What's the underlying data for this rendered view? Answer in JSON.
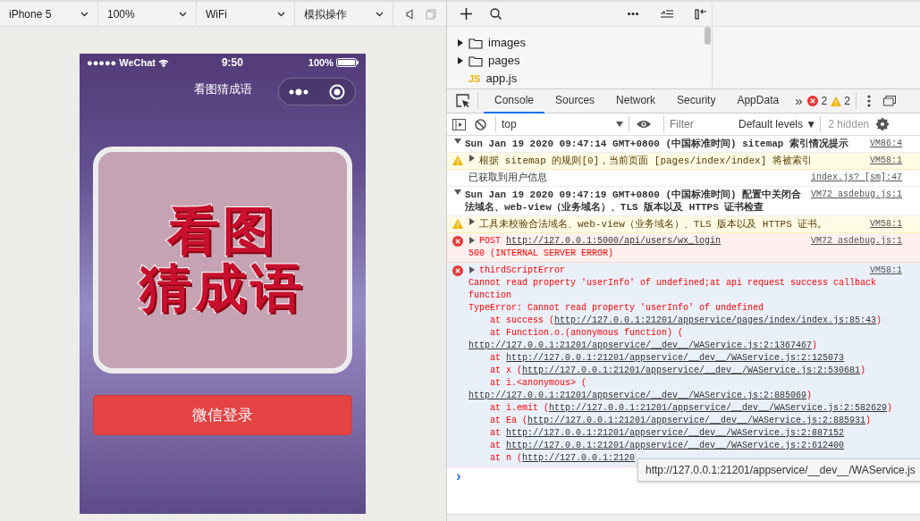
{
  "simulator_toolbar": {
    "dropdowns": [
      {
        "label": "iPhone 5"
      },
      {
        "label": "100%"
      },
      {
        "label": "WiFi"
      },
      {
        "label": "模拟操作"
      }
    ]
  },
  "phone": {
    "status_bar": {
      "carrier": "●●●●● WeChat",
      "time": "9:50",
      "battery": "100%"
    },
    "nav_title": "看图猜成语",
    "logo": {
      "lines": [
        "看图",
        "猜成语"
      ]
    },
    "login_button": "微信登录"
  },
  "file_tree": {
    "items": [
      {
        "label": "images",
        "kind": "folder",
        "expanded": false
      },
      {
        "label": "pages",
        "kind": "folder",
        "expanded": false
      },
      {
        "label": "app.js",
        "kind": "js",
        "badge": "JS"
      }
    ]
  },
  "devtools": {
    "tabs": [
      {
        "label": "Console",
        "selected": true
      },
      {
        "label": "Sources",
        "selected": false
      },
      {
        "label": "Network",
        "selected": false
      },
      {
        "label": "Security",
        "selected": false
      },
      {
        "label": "AppData",
        "selected": false
      }
    ],
    "more": "»",
    "error_count": "2",
    "warning_count": "2",
    "context": "top",
    "filter": {
      "placeholder": "Filter"
    },
    "levels": "Default levels ▼",
    "hidden": "2 hidden"
  },
  "console": {
    "messages": [
      {
        "kind": "group",
        "expanded": true,
        "highlighted": false,
        "text": "Sun Jan 19 2020 09:47:14 GMT+0800 (中国标准时间) sitemap 索引情况提示",
        "source": "VM86:4"
      },
      {
        "kind": "warning",
        "expanded": false,
        "highlighted": false,
        "text": "根据 sitemap 的规则[0]，当前页面 [pages/index/index] 将被索引",
        "source": "VM58:1"
      },
      {
        "kind": "log",
        "highlighted": false,
        "text": "已获取到用户信息",
        "source": "index.js? [sm]:47"
      },
      {
        "kind": "group",
        "expanded": true,
        "highlighted": false,
        "text": "Sun Jan 19 2020 09:47:19 GMT+0800 (中国标准时间) 配置中关闭合法域名、web-view（业务域名）、TLS 版本以及 HTTPS 证书检查",
        "source": "VM72 asdebug.js:1"
      },
      {
        "kind": "warning",
        "expanded": false,
        "highlighted": false,
        "text": "工具未校验合法域名、web-view（业务域名）、TLS 版本以及 HTTPS 证书。",
        "source": "VM58:1"
      },
      {
        "kind": "network_error",
        "expanded": false,
        "highlighted": false,
        "method": "POST",
        "url": "http://127.0.0.1:5000/api/users/wx_login",
        "status": "500 (INTERNAL SERVER ERROR)",
        "source": "VM72 asdebug.js:1"
      },
      {
        "kind": "script_error",
        "expanded": false,
        "highlighted": true,
        "title": "thirdScriptError",
        "source": "VM58:1",
        "lines": [
          "Cannot read property 'userInfo' of undefined;at api request success callback function",
          "TypeError: Cannot read property 'userInfo' of undefined"
        ],
        "stack": [
          {
            "before": "at success (",
            "url": "http://127.0.0.1:21201/appservice/pages/index/index.js:85:43",
            "after": ")"
          },
          {
            "before": "at Function.o.(anonymous function) (",
            "url": "http://127.0.0.1:21201/appservice/__dev__/WAService.js:2:1367467",
            "after": ")"
          },
          {
            "before": "at ",
            "url": "http://127.0.0.1:21201/appservice/__dev__/WAService.js:2:125073"
          },
          {
            "before": "at x (",
            "url": "http://127.0.0.1:21201/appservice/__dev__/WAService.js:2:530681",
            "after": ")"
          },
          {
            "before": "at i.<anonymous> (",
            "url": "http://127.0.0.1:21201/appservice/__dev__/WAService.js:2:885069",
            "after": ")"
          },
          {
            "before": "at i.emit (",
            "url": "http://127.0.0.1:21201/appservice/__dev__/WAService.js:2:582629",
            "after": ")"
          },
          {
            "before": "at Ea (",
            "url": "http://127.0.0.1:21201/appservice/__dev__/WAService.js:2:885931",
            "after": ")"
          },
          {
            "before": "at ",
            "url": "http://127.0.0.1:21201/appservice/__dev__/WAService.js:2:887152"
          },
          {
            "before": "at ",
            "url": "http://127.0.0.1:21201/appservice/__dev__/WAService.js:2:612400"
          },
          {
            "before": "at n (",
            "url": "http://127.0.0.1:2120"
          }
        ]
      }
    ],
    "prompt": "›",
    "tooltip": "http://127.0.0.1:21201/appservice/__dev__/WAService.js"
  }
}
